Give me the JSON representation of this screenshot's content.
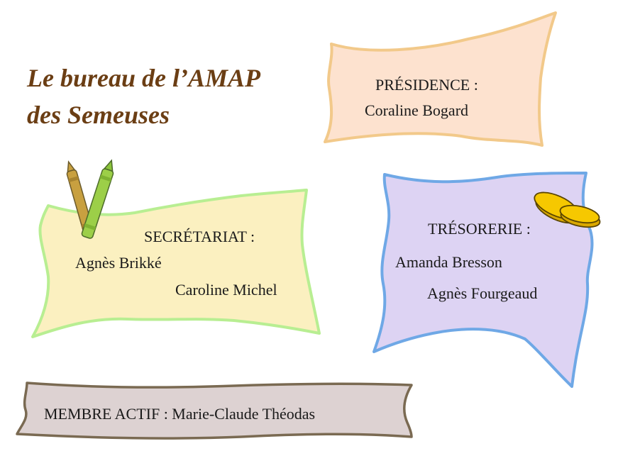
{
  "title": {
    "line1": "Le bureau de l’AMAP",
    "line2": "des Semeuses"
  },
  "presidence": {
    "heading": "PRÉSIDENCE :",
    "names": [
      "Coraline Bogard"
    ]
  },
  "secretariat": {
    "heading": "SECRÉTARIAT :",
    "names": [
      "Agnès Brikké",
      "Caroline Michel"
    ]
  },
  "tresorerie": {
    "heading": "TRÉSORERIE :",
    "names": [
      "Amanda Bresson",
      "Agnès Fourgeaud"
    ]
  },
  "membre": {
    "text": "MEMBRE ACTIF : Marie-Claude Théodas"
  },
  "colors": {
    "title": "#6b3e14",
    "presidence_fill": "#fde2cf",
    "presidence_stroke": "#f2c98a",
    "secretariat_fill": "#fbf0c0",
    "secretariat_stroke": "#b8ee92",
    "tresorerie_fill": "#ddd3f3",
    "tresorerie_stroke": "#6fa8e6",
    "membre_fill": "#ddd2d2",
    "membre_stroke": "#7a6a52"
  },
  "icons": [
    "crayons-icon",
    "coins-icon"
  ]
}
